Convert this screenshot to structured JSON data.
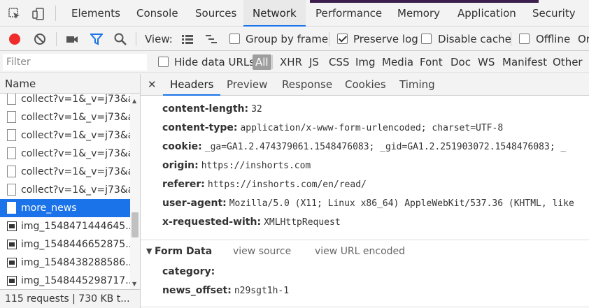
{
  "main_tabs": {
    "elements": "Elements",
    "console": "Console",
    "sources": "Sources",
    "network": "Network",
    "performance": "Performance",
    "memory": "Memory",
    "application": "Application",
    "security": "Security"
  },
  "toolbar": {
    "view_label": "View:",
    "group_by_frame": "Group by frame",
    "preserve_log": "Preserve log",
    "disable_cache": "Disable cache",
    "offline": "Offline",
    "throttle_cut": "Or"
  },
  "filter": {
    "placeholder": "Filter",
    "hide_data_urls": "Hide data URLs",
    "types": [
      "All",
      "XHR",
      "JS",
      "CSS",
      "Img",
      "Media",
      "Font",
      "Doc",
      "WS",
      "Manifest",
      "Other"
    ]
  },
  "request_list": {
    "header": "Name",
    "rows": [
      {
        "name": "collect?v=1&_v=j73&a...",
        "icon": "document-icon"
      },
      {
        "name": "collect?v=1&_v=j73&a...",
        "icon": "document-icon"
      },
      {
        "name": "collect?v=1&_v=j73&a...",
        "icon": "document-icon"
      },
      {
        "name": "collect?v=1&_v=j73&a...",
        "icon": "document-icon"
      },
      {
        "name": "collect?v=1&_v=j73&a...",
        "icon": "document-icon"
      },
      {
        "name": "collect?v=1&_v=j73&a...",
        "icon": "document-icon"
      },
      {
        "name": "more_news",
        "icon": "document-icon",
        "selected": true
      },
      {
        "name": "img_1548471444645...",
        "icon": "image-icon"
      },
      {
        "name": "img_1548446652875...",
        "icon": "image-icon"
      },
      {
        "name": "img_1548438288586...",
        "icon": "image-icon"
      },
      {
        "name": "img_1548445298717...",
        "icon": "image-icon"
      }
    ],
    "status": "115 requests  |  730 KB t..."
  },
  "detail_tabs": {
    "headers": "Headers",
    "preview": "Preview",
    "response": "Response",
    "cookies": "Cookies",
    "timing": "Timing"
  },
  "request_headers": [
    {
      "key": "content-length:",
      "value": "32"
    },
    {
      "key": "content-type:",
      "value": "application/x-www-form-urlencoded; charset=UTF-8"
    },
    {
      "key": "cookie:",
      "value": "_ga=GA1.2.474379061.1548476083; _gid=GA1.2.251903072.1548476083; _"
    },
    {
      "key": "origin:",
      "value": "https://inshorts.com"
    },
    {
      "key": "referer:",
      "value": "https://inshorts.com/en/read/"
    },
    {
      "key": "user-agent:",
      "value": "Mozilla/5.0 (X11; Linux x86_64) AppleWebKit/537.36 (KHTML, like"
    },
    {
      "key": "x-requested-with:",
      "value": "XMLHttpRequest"
    }
  ],
  "form_data": {
    "title": "Form Data",
    "view_source": "view source",
    "view_url_encoded": "view URL encoded",
    "fields": [
      {
        "key": "category:",
        "value": ""
      },
      {
        "key": "news_offset:",
        "value": "n29sgt1h-1"
      }
    ]
  },
  "colors": {
    "accent": "#1a73e8",
    "record": "#ef2b2b",
    "filter_icon": "#1a73e8"
  }
}
